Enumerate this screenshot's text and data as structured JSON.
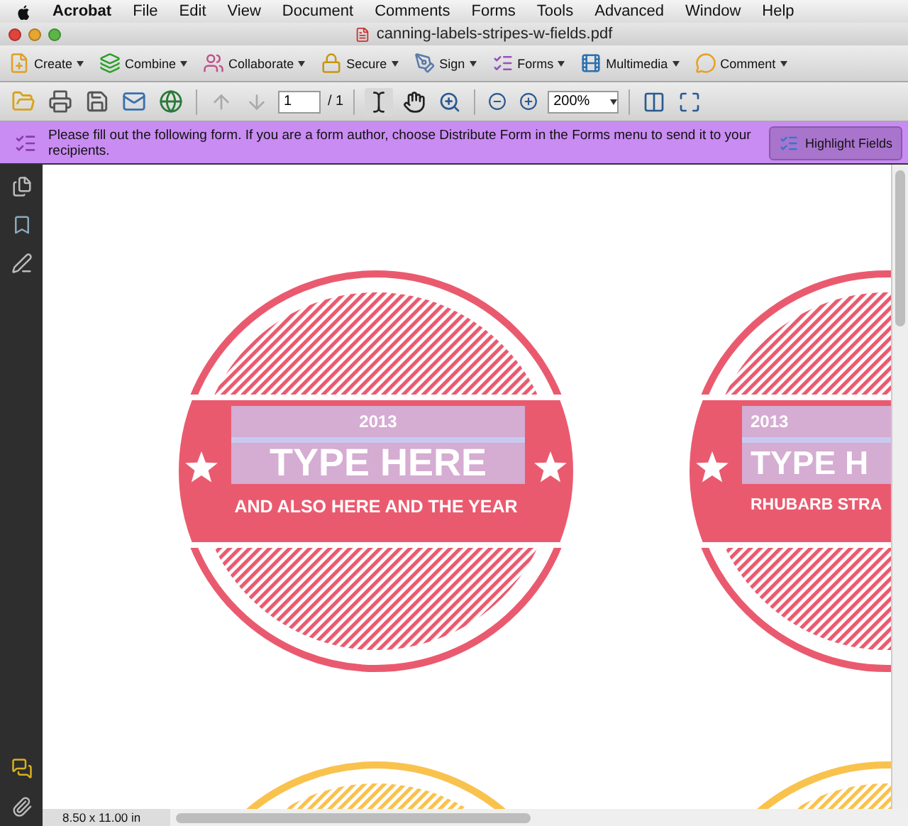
{
  "menu_bar": {
    "app": "Acrobat",
    "items": [
      "File",
      "Edit",
      "View",
      "Document",
      "Comments",
      "Forms",
      "Tools",
      "Advanced",
      "Window",
      "Help"
    ]
  },
  "window": {
    "title": "canning-labels-stripes-w-fields.pdf"
  },
  "tasks_toolbar": [
    {
      "label": "Create",
      "kind": "create"
    },
    {
      "label": "Combine",
      "kind": "combine"
    },
    {
      "label": "Collaborate",
      "kind": "collaborate"
    },
    {
      "label": "Secure",
      "kind": "secure"
    },
    {
      "label": "Sign",
      "kind": "sign"
    },
    {
      "label": "Forms",
      "kind": "forms"
    },
    {
      "label": "Multimedia",
      "kind": "multimedia"
    },
    {
      "label": "Comment",
      "kind": "comment"
    }
  ],
  "page_toolbar": {
    "page": "1",
    "page_total": "/ 1",
    "zoom": "200%"
  },
  "form_bar": {
    "message": "Please fill out the following form. If you are a form author, choose Distribute Form in the Forms menu to send it to your recipients.",
    "button": "Highlight Fields"
  },
  "labels": [
    {
      "kind": "full",
      "color": "#ea5a6f",
      "year": "2013",
      "title": "TYPE HERE",
      "subtitle": "AND ALSO HERE AND THE YEAR"
    },
    {
      "kind": "cut",
      "color": "#ea5a6f",
      "year": "2013",
      "title": "TYPE H",
      "subtitle": "RHUBARB STRA"
    },
    {
      "kind": "blank",
      "color": "#f9c24d"
    },
    {
      "kind": "blank",
      "color": "#f9c24d"
    }
  ],
  "status_bar": {
    "page_size": "8.50 x 11.00 in"
  }
}
